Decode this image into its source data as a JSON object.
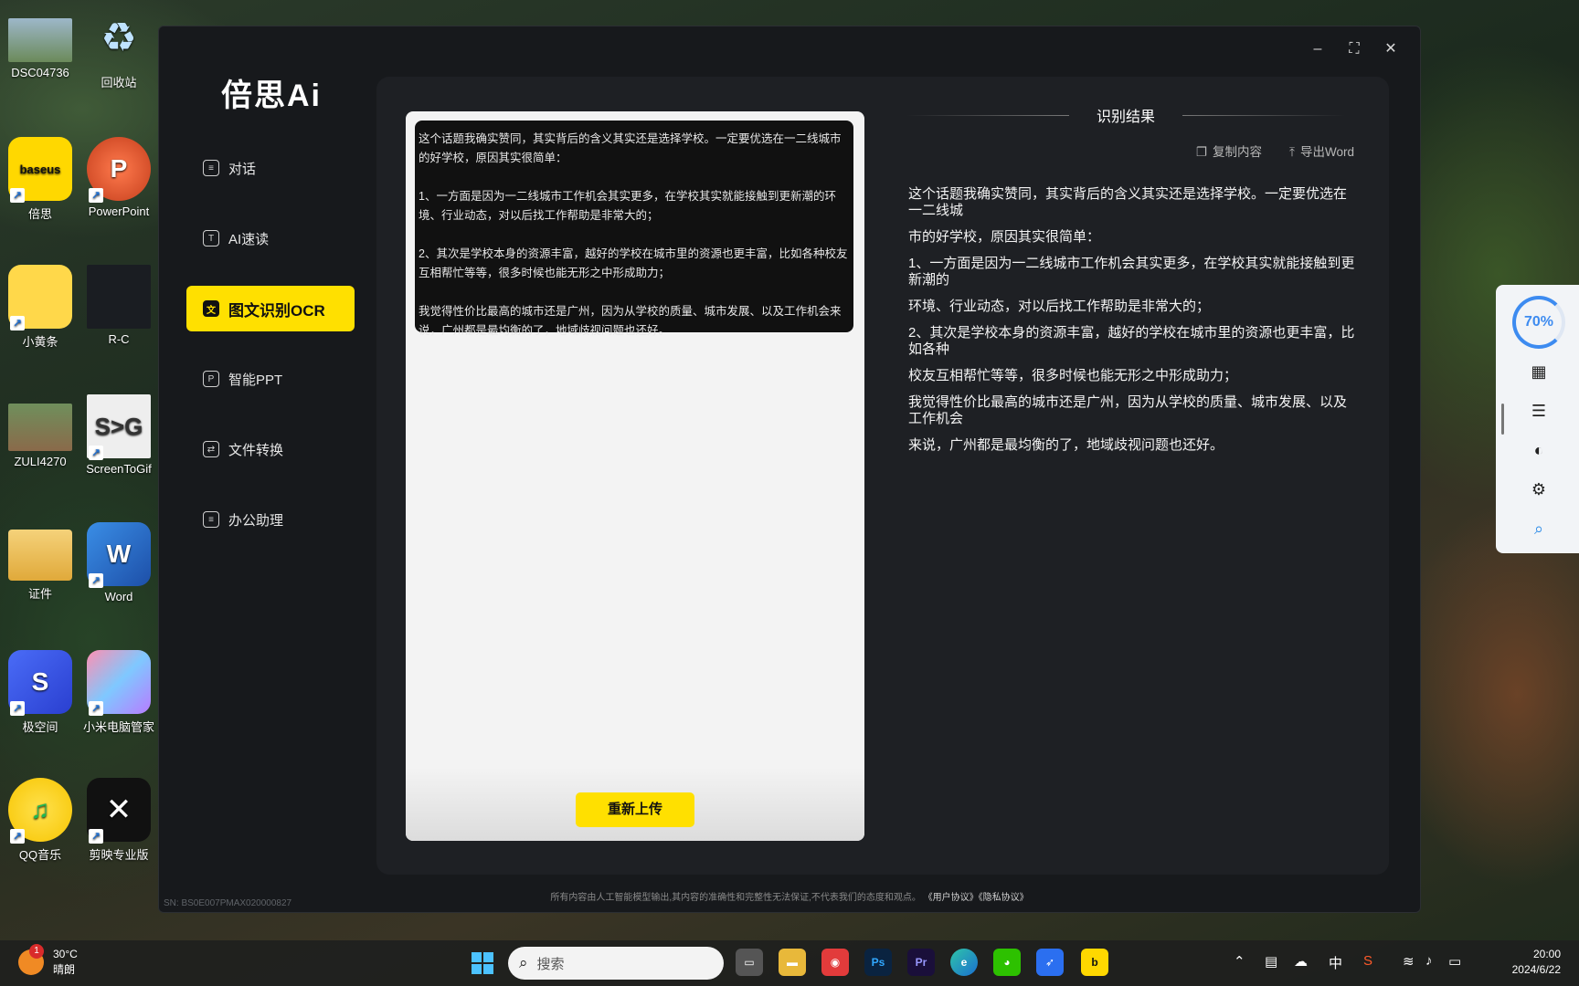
{
  "desktop": {
    "icons": [
      {
        "label": "DSC04736"
      },
      {
        "label": "回收站"
      },
      {
        "label": "倍思"
      },
      {
        "label": "PowerPoint"
      },
      {
        "label": "小黄条"
      },
      {
        "label": "R-C"
      },
      {
        "label": "ZULI4270"
      },
      {
        "label": "ScreenToGif"
      },
      {
        "label": "证件"
      },
      {
        "label": "Word"
      },
      {
        "label": "极空间"
      },
      {
        "label": "小米电脑管家"
      },
      {
        "label": "QQ音乐"
      },
      {
        "label": "剪映专业版"
      }
    ],
    "baseus_text": "baseus",
    "screentogif_text": "S>G"
  },
  "app": {
    "logo": "倍思Ai",
    "window_controls": {
      "minimize": "–",
      "maximize": "⛶",
      "close": "✕"
    },
    "nav": [
      {
        "label": "对话",
        "icon": "chat-icon"
      },
      {
        "label": "AI速读",
        "icon": "text-icon"
      },
      {
        "label": "图文识别OCR",
        "icon": "ocr-icon",
        "active": true
      },
      {
        "label": "智能PPT",
        "icon": "ppt-icon"
      },
      {
        "label": "文件转换",
        "icon": "folder-icon"
      },
      {
        "label": "办公助理",
        "icon": "doc-icon"
      }
    ],
    "preview": {
      "paragraphs": [
        "这个话题我确实赞同，其实背后的含义其实还是选择学校。一定要优选在一二线城市的好学校，原因其实很简单：",
        "1、一方面是因为一二线城市工作机会其实更多，在学校其实就能接触到更新潮的环境、行业动态，对以后找工作帮助是非常大的；",
        "2、其次是学校本身的资源丰富，越好的学校在城市里的资源也更丰富，比如各种校友互相帮忙等等，很多时候也能无形之中形成助力；",
        "我觉得性价比最高的城市还是广州，因为从学校的质量、城市发展、以及工作机会来说，广州都是最均衡的了，地域歧视问题也还好。"
      ]
    },
    "reupload_label": "重新上传",
    "result": {
      "title": "识别结果",
      "copy_label": "复制内容",
      "export_label": "导出Word",
      "lines": [
        "这个话题我确实赞同，其实背后的含义其实还是选择学校。一定要优选在一二线城",
        "市的好学校，原因其实很简单：",
        "1、一方面是因为一二线城市工作机会其实更多，在学校其实就能接触到更新潮的",
        "环境、行业动态，对以后找工作帮助是非常大的；",
        "2、其次是学校本身的资源丰富，越好的学校在城市里的资源也更丰富，比如各种",
        "校友互相帮忙等等，很多时候也能无形之中形成助力；",
        "我觉得性价比最高的城市还是广州，因为从学校的质量、城市发展、以及工作机会",
        "来说，广州都是最均衡的了，地域歧视问题也还好。"
      ]
    },
    "footer": {
      "disclaimer": "所有内容由人工智能模型输出,其内容的准确性和完整性无法保证,不代表我们的态度和观点。",
      "user_agreement": "《用户协议》",
      "privacy": "《隐私协议》",
      "sn": "SN: BS0E007PMAX020000827"
    }
  },
  "float_toolbar": {
    "gauge_percent": 70,
    "gauge_label": "70%"
  },
  "taskbar": {
    "weather_temp": "30°C",
    "weather_desc": "晴朗",
    "weather_badge": "1",
    "search_placeholder": "搜索",
    "apps": [
      "Ps",
      "Pr"
    ],
    "ime": "中",
    "time": "20:00",
    "date": "2024/6/22"
  }
}
